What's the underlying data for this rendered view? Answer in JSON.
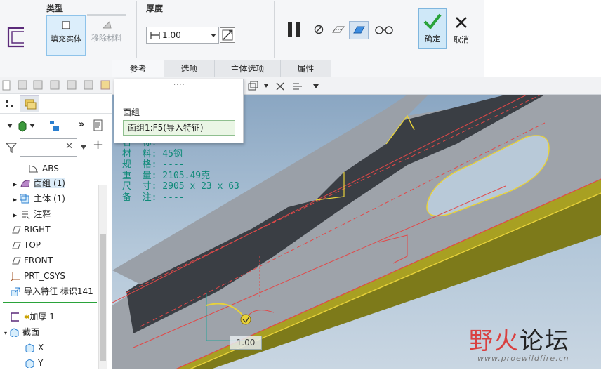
{
  "ribbon": {
    "type_group": {
      "label": "类型",
      "fill_solid": "填充实体",
      "remove_material": "移除材料"
    },
    "thickness_group": {
      "label": "厚度",
      "value": "1.00"
    },
    "ok": "确定",
    "cancel": "取消",
    "tabs": [
      "参考",
      "选项",
      "主体选项",
      "属性"
    ]
  },
  "popup": {
    "title": "面组",
    "selection": "面组1:F5(导入特征)"
  },
  "tree": {
    "items": [
      {
        "label": "ABS"
      },
      {
        "label": "面组 (1)"
      },
      {
        "label": "主体 (1)"
      },
      {
        "label": "注释"
      },
      {
        "label": "RIGHT"
      },
      {
        "label": "TOP"
      },
      {
        "label": "FRONT"
      },
      {
        "label": "PRT_CSYS"
      },
      {
        "label": "导入特征 标识141"
      },
      {
        "label": "加厚 1"
      },
      {
        "label": "截面"
      },
      {
        "label": "X"
      },
      {
        "label": "Y"
      }
    ]
  },
  "info": {
    "lines": [
      "名  称: ----",
      "材  料: 45钢",
      "规  格: ----",
      "重  量: 2105.49克",
      "尺  寸: 2905 x 23 x 63",
      "备  注: ----"
    ]
  },
  "dimension": "1.00",
  "watermark": {
    "text_part1": "野火",
    "text_part2": "论坛",
    "url": "www.proewildfire.cn"
  },
  "colors": {
    "accent": "#2a7fd0",
    "ok_green": "#2aa33a",
    "model_gray": "#9aa0a8",
    "model_dark": "#3a3e44",
    "edge_yellow": "#e8d23a",
    "edge_red": "#e24848",
    "info_text": "#0e8a78"
  }
}
